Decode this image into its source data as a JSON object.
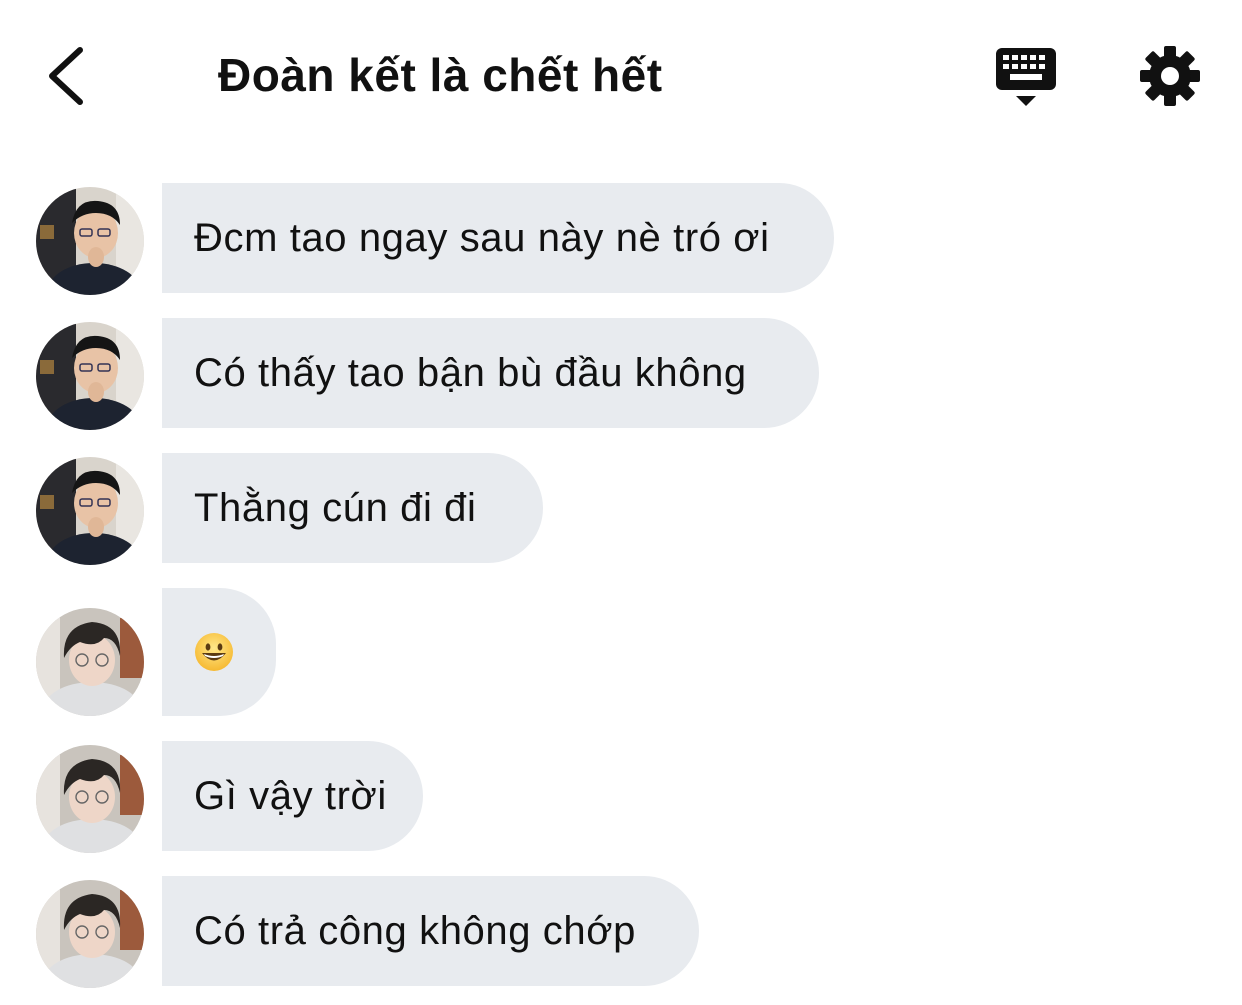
{
  "header": {
    "title": "Đoàn kết là chết hết",
    "back_icon": "chevron-left-icon",
    "keyboard_icon": "keyboard-hide-icon",
    "settings_icon": "gear-icon"
  },
  "messages": [
    {
      "sender": "user-a",
      "text": "Đcm tao ngay sau này nè tró ơi"
    },
    {
      "sender": "user-a",
      "text": "Có thấy tao bận bù đầu không"
    },
    {
      "sender": "user-a",
      "text": "Thằng cún đi đi"
    },
    {
      "sender": "user-b",
      "emoji": "grinning-face-icon"
    },
    {
      "sender": "user-b",
      "text": "Gì vậy trời"
    },
    {
      "sender": "user-b",
      "text": "Có trả công không chớp"
    }
  ],
  "colors": {
    "bubble": "#e8ebef",
    "text": "#111111",
    "background": "#ffffff"
  }
}
